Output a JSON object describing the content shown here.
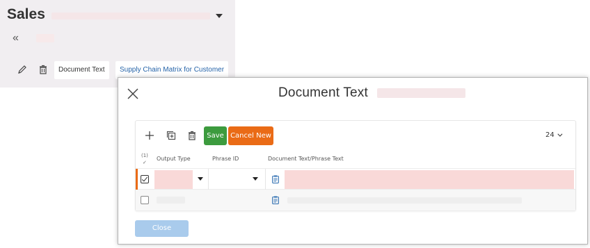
{
  "app": {
    "title": "Sales",
    "collapse_glyph": "«",
    "tabs": [
      {
        "label": "Document Text"
      },
      {
        "label": "Supply Chain Matrix for Customer"
      }
    ]
  },
  "modal": {
    "title": "Document Text",
    "toolbar": {
      "save_label": "Save",
      "cancel_new_label": "Cancel New",
      "page_size": "24"
    },
    "grid": {
      "selected_count": "(1)",
      "columns": [
        "Output Type",
        "Phrase ID",
        "Document Text/Phrase Text"
      ],
      "rows": [
        {
          "checked": true,
          "output_type": "",
          "phrase_id": "",
          "text": ""
        },
        {
          "checked": false,
          "output_type": "",
          "phrase_id": "",
          "text": ""
        }
      ]
    },
    "close_label": "Close"
  },
  "colors": {
    "save": "#3c9b3e",
    "cancel_new": "#ea6b16",
    "required_field": "#f9d9d8",
    "link": "#2563a8",
    "close_disabled": "#a9cbec"
  },
  "icons": [
    "pencil-icon",
    "trash-icon",
    "close-icon",
    "plus-icon",
    "copy-icon",
    "clipboard-icon",
    "chevron-down-icon",
    "double-chevron-left-icon"
  ]
}
